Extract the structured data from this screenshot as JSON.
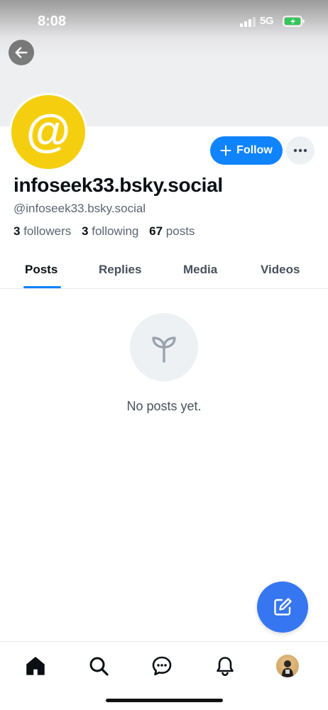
{
  "status_bar": {
    "time": "8:08",
    "network": "5G",
    "icons": [
      "signal-icon",
      "battery-charging-icon"
    ]
  },
  "profile": {
    "avatar_glyph": "@",
    "avatar_color": "#f5cf0f",
    "display_name": "infoseek33.bsky.social",
    "handle": "@infoseek33.bsky.social",
    "followers_count": "3",
    "followers_label": "followers",
    "following_count": "3",
    "following_label": "following",
    "posts_count": "67",
    "posts_label": "posts"
  },
  "actions": {
    "follow_label": "Follow",
    "more_icon": "ellipsis-icon",
    "back_icon": "arrow-left-icon"
  },
  "tabs": [
    {
      "label": "Posts",
      "active": true
    },
    {
      "label": "Replies",
      "active": false
    },
    {
      "label": "Media",
      "active": false
    },
    {
      "label": "Videos",
      "active": false
    }
  ],
  "empty_state": {
    "icon": "seedling-icon",
    "text": "No posts yet."
  },
  "fab": {
    "icon": "compose-icon"
  },
  "bottom_nav": [
    "home-icon",
    "search-icon",
    "chat-icon",
    "bell-icon",
    "profile-avatar"
  ],
  "colors": {
    "accent": "#1083fe",
    "fab": "#3676f0",
    "muted_text": "#5a6572"
  }
}
